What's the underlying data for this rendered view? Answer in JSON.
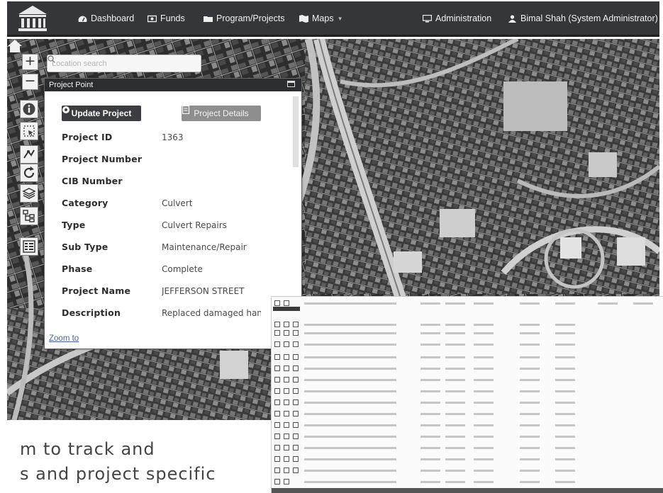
{
  "nav": {
    "items": [
      {
        "label": "Dashboard",
        "icon": "dashboard-icon"
      },
      {
        "label": "Funds",
        "icon": "money-icon"
      },
      {
        "label": "Program/Projects",
        "icon": "folder-icon"
      },
      {
        "label": "Maps",
        "icon": "map-icon"
      },
      {
        "label": "Administration",
        "icon": "monitor-icon"
      },
      {
        "label": "Bimal Shah (System Administrator)",
        "icon": "user-icon"
      }
    ]
  },
  "map": {
    "search_placeholder": "Location search",
    "zoom_in": "+",
    "zoom_out": "−",
    "tools": [
      "info-icon",
      "select-icon",
      "measure-icon",
      "refresh-icon",
      "layers-icon",
      "tree-icon",
      "legend-icon"
    ]
  },
  "panel": {
    "title": "Project Point",
    "update_label": "Update Project",
    "details_label": "Project Details",
    "fields": [
      {
        "key": "Project ID",
        "value": "1363"
      },
      {
        "key": "Project Number",
        "value": ""
      },
      {
        "key": "CIB Number",
        "value": ""
      },
      {
        "key": "Category",
        "value": "Culvert"
      },
      {
        "key": "Type",
        "value": "Culvert Repairs"
      },
      {
        "key": "Sub Type",
        "value": "Maintenance/Repair"
      },
      {
        "key": "Phase",
        "value": "Complete"
      },
      {
        "key": "Project Name",
        "value": "JEFFERSON STREET"
      },
      {
        "key": "Description",
        "value": "Replaced damaged handr"
      }
    ],
    "zoom_to": "Zoom to"
  },
  "page_text": {
    "line1": "m   to   track   and",
    "line2": "s    and    project    specific"
  },
  "colors": {
    "nav_bg": "#35363a",
    "panel_header_bg": "#2c2d30",
    "update_button_bg": "#3c3d40",
    "details_button_bg": "#8e8e8e",
    "link": "#4a64a8"
  }
}
